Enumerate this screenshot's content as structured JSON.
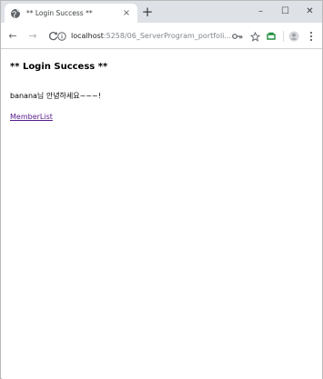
{
  "browser": {
    "tab": {
      "title": "** Login Success **",
      "favicon": "globe-icon",
      "close_glyph": "×"
    },
    "new_tab_glyph": "+",
    "window_controls": {
      "minimize": "–",
      "maximize": "☐",
      "close": "✕"
    },
    "nav": {
      "back": "←",
      "forward": "→",
      "reload": "C"
    },
    "url": {
      "host": "localhost",
      "rest": ":5258/06_ServerProgram_portfoli..."
    },
    "tools": [
      "key-icon",
      "star-icon",
      "extension-icon",
      "profile-icon",
      "menu-icon"
    ]
  },
  "page": {
    "heading": "** Login Success **",
    "greeting": "banana님 안녕하세요~~~!",
    "link_label": "MemberList"
  },
  "colors": {
    "link_visited": "#551a8b",
    "tabstrip": "#dee1e6",
    "accent_green": "#1e8e3e"
  }
}
